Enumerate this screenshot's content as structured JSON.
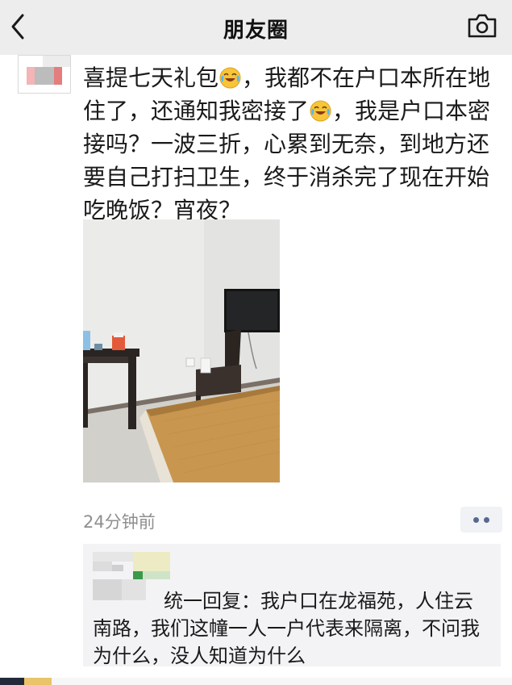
{
  "navbar": {
    "title": "朋友圈",
    "back_icon": "chevron-left-icon",
    "camera_icon": "camera-icon"
  },
  "post": {
    "lines": [
      [
        "喜提七天礼包",
        "，我都不在户口本所在地"
      ],
      [
        "住了，还通知我密接了",
        "，我是户口本密"
      ],
      [
        "接吗？一波三折，心累到无奈，到地方还"
      ],
      [
        "要自己打扫卫生，终于消杀完了现在开始"
      ],
      [
        "吃晚饭？宵夜？"
      ]
    ],
    "emoji_icon": "laughing-tears-emoji-icon",
    "photo_description_icon": "hotel-room-photo",
    "timestamp": "24分钟前",
    "more_icon": "more-dots-icon"
  },
  "comment": {
    "lines": [
      "统一回复：我户口在龙福苑，人住云",
      "南路，我们这幢一人一户代表来隔离，不问我",
      "为什么，没人知道为什么"
    ]
  },
  "colors": {
    "navbar_bg": "#ededed",
    "link_blue": "#56698f",
    "timestamp_gray": "#8f8f8f",
    "comment_bg": "#f3f3f5"
  }
}
